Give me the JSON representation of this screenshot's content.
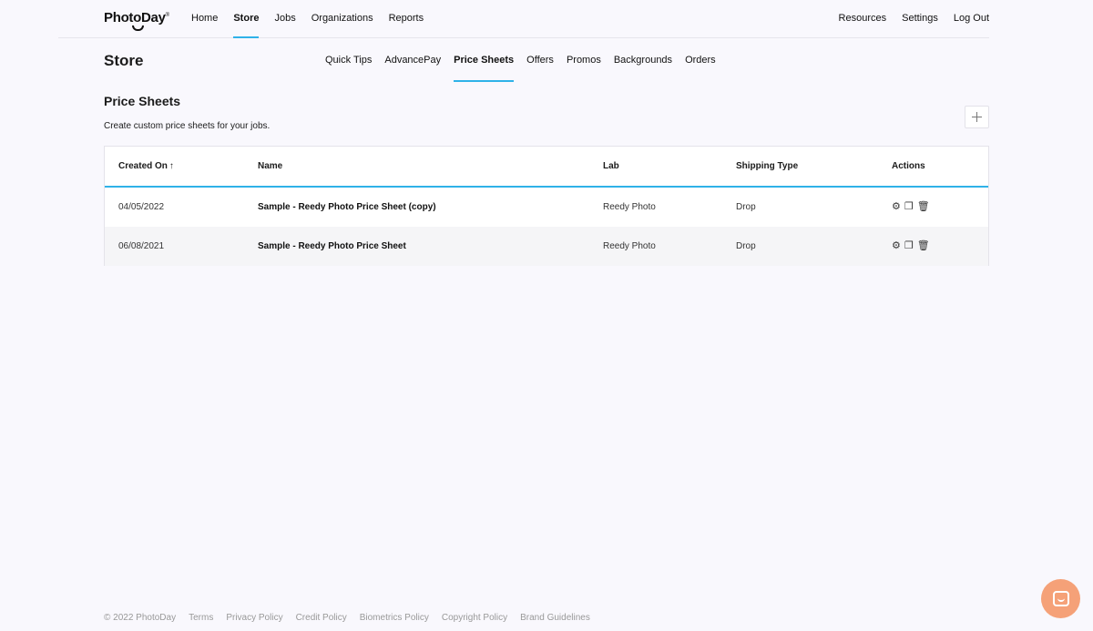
{
  "brand": {
    "logo_text": "PhotoDay",
    "logo_mark": "®"
  },
  "topnav": {
    "left": [
      {
        "label": "Home"
      },
      {
        "label": "Store"
      },
      {
        "label": "Jobs"
      },
      {
        "label": "Organizations"
      },
      {
        "label": "Reports"
      }
    ],
    "right": [
      {
        "label": "Resources"
      },
      {
        "label": "Settings"
      },
      {
        "label": "Log Out"
      }
    ]
  },
  "page": {
    "title": "Store"
  },
  "subnav": [
    {
      "label": "Quick Tips"
    },
    {
      "label": "AdvancePay"
    },
    {
      "label": "Price Sheets"
    },
    {
      "label": "Offers"
    },
    {
      "label": "Promos"
    },
    {
      "label": "Backgrounds"
    },
    {
      "label": "Orders"
    }
  ],
  "section": {
    "title": "Price Sheets",
    "description": "Create custom price sheets for your jobs.",
    "add_icon": "plus-icon"
  },
  "table": {
    "headers": {
      "created_on": "Created On",
      "sort_icon": "↑",
      "name": "Name",
      "lab": "Lab",
      "shipping": "Shipping Type",
      "actions": "Actions"
    },
    "rows": [
      {
        "created_on": "04/05/2022",
        "name": "Sample - Reedy Photo Price Sheet (copy)",
        "lab": "Reedy Photo",
        "shipping": "Drop"
      },
      {
        "created_on": "06/08/2021",
        "name": "Sample - Reedy Photo Price Sheet",
        "lab": "Reedy Photo",
        "shipping": "Drop"
      }
    ],
    "action_icons": [
      "gear-icon",
      "copy-icon",
      "trash-icon"
    ]
  },
  "footer": {
    "copyright": "© 2022 PhotoDay",
    "links": [
      {
        "label": "Terms"
      },
      {
        "label": "Privacy Policy"
      },
      {
        "label": "Credit Policy"
      },
      {
        "label": "Biometrics Policy"
      },
      {
        "label": "Copyright Policy"
      },
      {
        "label": "Brand Guidelines"
      }
    ]
  },
  "colors": {
    "accent": "#2fb2e8",
    "chat": "#f5a178",
    "background": "#f9f8fd"
  }
}
